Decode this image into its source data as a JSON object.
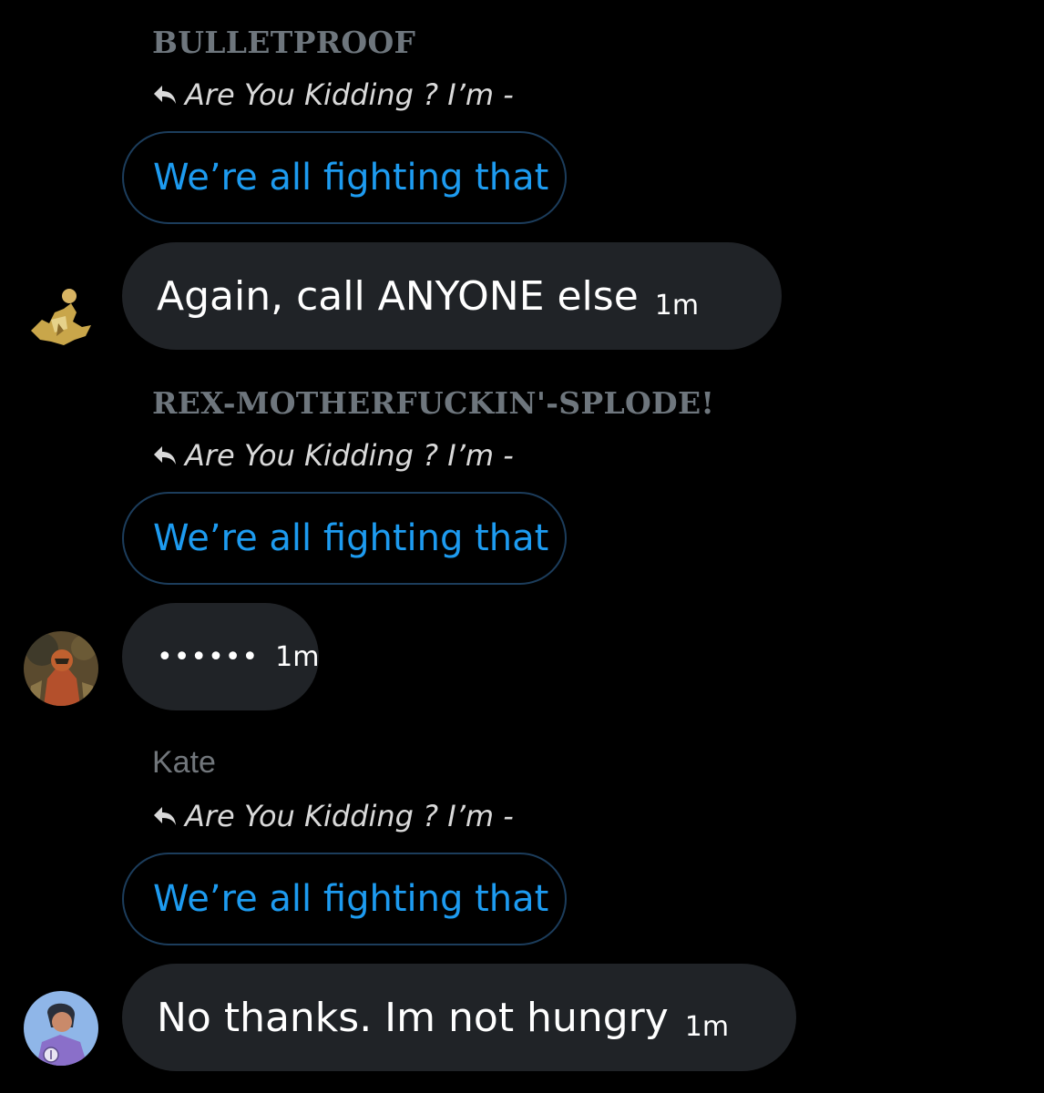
{
  "messages": [
    {
      "sender": "BULLETPROOF",
      "reply_context": "Are You Kidding ? I’m -",
      "quoted": "We’re all fighting that",
      "text": "Again, call ANYONE else",
      "time": "1m"
    },
    {
      "sender": "REX-MOTHERFUCKIN'-SPLODE!",
      "reply_context": "Are You Kidding ? I’m -",
      "quoted": "We’re all fighting that",
      "text": "••••••",
      "time": "1m"
    },
    {
      "sender": "Kate",
      "reply_context": "Are You Kidding ? I’m -",
      "quoted": "We’re all fighting that",
      "text": "No thanks. Im not hungry",
      "time": "1m"
    }
  ],
  "colors": {
    "background": "#000000",
    "bubble": "#202327",
    "accent": "#1d9bf0",
    "muted": "#6e767d"
  },
  "icons": {
    "reply": "reply-arrow-icon"
  }
}
